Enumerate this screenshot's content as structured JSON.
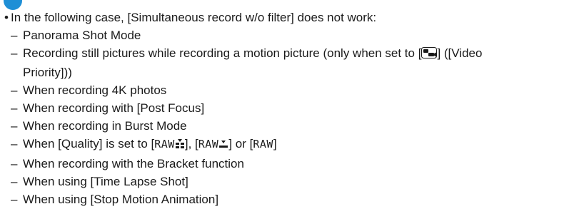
{
  "note": {
    "icon": "note-icon",
    "accent_color": "#1e8fd6",
    "lead_bullet": "•",
    "lead_text": "In the following case, [Simultaneous record w/o filter] does not work:",
    "dash": "–",
    "items": [
      "Panorama Shot Mode",
      "Recording still pictures while recording a motion picture (only when set to [",
      "When recording 4K photos",
      "When recording with [Post Focus]",
      "When recording in Burst Mode",
      "When using [Time Lapse Shot]",
      "When using [Stop Motion Animation]"
    ],
    "video_priority": {
      "icon": "video-priority-icon",
      "suffix_line1": "] ([Video",
      "line2": "Priority]))"
    },
    "quality_item": {
      "prefix": "When [Quality] is set to [",
      "chip1": "RAW",
      "chip1_icon": "raw-fine-icon",
      "mid1": "], [",
      "chip2": "RAW",
      "chip2_icon": "raw-standard-icon",
      "mid2": "] or [",
      "chip3": "RAW",
      "suffix": "]"
    },
    "bracket_item": "When recording with the Bracket function"
  }
}
